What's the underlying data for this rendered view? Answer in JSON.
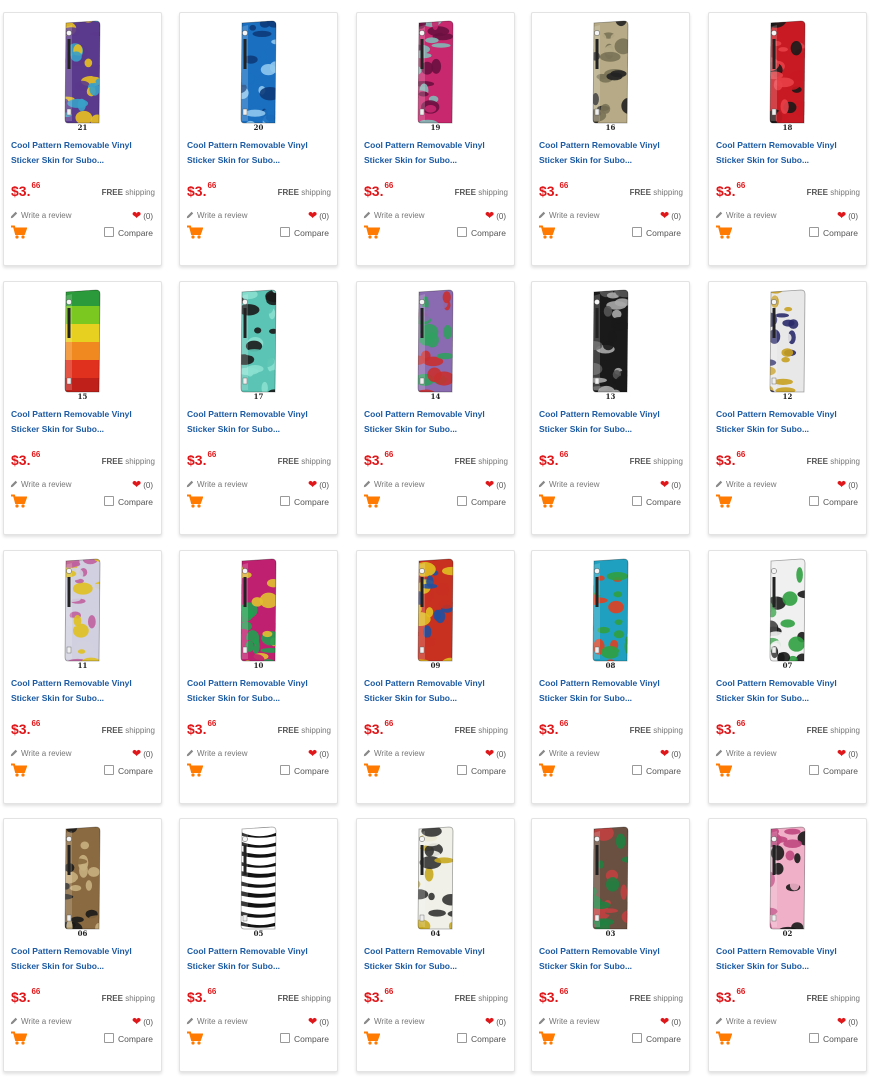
{
  "colors": {
    "title": "#1b5aa3",
    "price": "#e0171a",
    "cart": "#ff7a00"
  },
  "products": [
    {
      "number": "21",
      "title_line1": "Cool Pattern Removable Vinyl",
      "title_line2": "Sticker Skin for Subo...",
      "price_whole": "$3.",
      "price_cents": "66",
      "shipping_free": "FREE",
      "shipping_label": "shipping",
      "review_label": "Write a review",
      "wishlist_count": "(0)",
      "compare_label": "Compare",
      "pattern": "cartoon-monsters",
      "c1": "#5a3a8c",
      "c2": "#e8c020",
      "c3": "#3aa0c8"
    },
    {
      "number": "20",
      "title_line1": "Cool Pattern Removable Vinyl",
      "title_line2": "Sticker Skin for Subo...",
      "price_whole": "$3.",
      "price_cents": "66",
      "shipping_free": "FREE",
      "shipping_label": "shipping",
      "review_label": "Write a review",
      "wishlist_count": "(0)",
      "compare_label": "Compare",
      "pattern": "blue-camo",
      "c1": "#1a6fc0",
      "c2": "#8fc8ee",
      "c3": "#0d3b7a"
    },
    {
      "number": "19",
      "title_line1": "Cool Pattern Removable Vinyl",
      "title_line2": "Sticker Skin for Subo...",
      "price_whole": "$3.",
      "price_cents": "66",
      "shipping_free": "FREE",
      "shipping_label": "shipping",
      "review_label": "Write a review",
      "wishlist_count": "(0)",
      "compare_label": "Compare",
      "pattern": "pink-waves",
      "c1": "#c8286e",
      "c2": "#7fb9b5",
      "c3": "#6a1040"
    },
    {
      "number": "16",
      "title_line1": "Cool Pattern Removable Vinyl",
      "title_line2": "Sticker Skin for Subo...",
      "price_whole": "$3.",
      "price_cents": "66",
      "shipping_free": "FREE",
      "shipping_label": "shipping",
      "review_label": "Write a review",
      "wishlist_count": "(0)",
      "compare_label": "Compare",
      "pattern": "beige-swirl",
      "c1": "#b6ab86",
      "c2": "#222222",
      "c3": "#7a7256"
    },
    {
      "number": "18",
      "title_line1": "Cool Pattern Removable Vinyl",
      "title_line2": "Sticker Skin for Subo...",
      "price_whole": "$3.",
      "price_cents": "66",
      "shipping_free": "FREE",
      "shipping_label": "shipping",
      "review_label": "Write a review",
      "wishlist_count": "(0)",
      "compare_label": "Compare",
      "pattern": "red-lace",
      "c1": "#c81a22",
      "c2": "#1a1a1a",
      "c3": "#e84048"
    },
    {
      "number": "15",
      "title_line1": "Cool Pattern Removable Vinyl",
      "title_line2": "Sticker Skin for Subo...",
      "price_whole": "$3.",
      "price_cents": "66",
      "shipping_free": "FREE",
      "shipping_label": "shipping",
      "review_label": "Write a review",
      "wishlist_count": "(0)",
      "compare_label": "Compare",
      "pattern": "rainbow-gradient",
      "c1": "#3cbc3c",
      "c2": "#f0c020",
      "c3": "#e0301e"
    },
    {
      "number": "17",
      "title_line1": "Cool Pattern Removable Vinyl",
      "title_line2": "Sticker Skin for Subo...",
      "price_whole": "$3.",
      "price_cents": "66",
      "shipping_free": "FREE",
      "shipping_label": "shipping",
      "review_label": "Write a review",
      "wishlist_count": "(0)",
      "compare_label": "Compare",
      "pattern": "teal-squiggle",
      "c1": "#5cc4b4",
      "c2": "#1a1a1a",
      "c3": "#8ae0d0"
    },
    {
      "number": "14",
      "title_line1": "Cool Pattern Removable Vinyl",
      "title_line2": "Sticker Skin for Subo...",
      "price_whole": "$3.",
      "price_cents": "66",
      "shipping_free": "FREE",
      "shipping_label": "shipping",
      "review_label": "Write a review",
      "wishlist_count": "(0)",
      "compare_label": "Compare",
      "pattern": "sticker-bomb",
      "c1": "#8a6ab0",
      "c2": "#c83030",
      "c3": "#30a060"
    },
    {
      "number": "13",
      "title_line1": "Cool Pattern Removable Vinyl",
      "title_line2": "Sticker Skin for Subo...",
      "price_whole": "$3.",
      "price_cents": "66",
      "shipping_free": "FREE",
      "shipping_label": "shipping",
      "review_label": "Write a review",
      "wishlist_count": "(0)",
      "compare_label": "Compare",
      "pattern": "black-floral",
      "c1": "#1a1a1a",
      "c2": "#aaaaaa",
      "c3": "#555555"
    },
    {
      "number": "12",
      "title_line1": "Cool Pattern Removable Vinyl",
      "title_line2": "Sticker Skin for Subo...",
      "price_whole": "$3.",
      "price_cents": "66",
      "shipping_free": "FREE",
      "shipping_label": "shipping",
      "review_label": "Write a review",
      "wishlist_count": "(0)",
      "compare_label": "Compare",
      "pattern": "license-plates",
      "c1": "#e8e8e8",
      "c2": "#2a2a6a",
      "c3": "#c8a020"
    },
    {
      "number": "11",
      "title_line1": "Cool Pattern Removable Vinyl",
      "title_line2": "Sticker Skin for Subo...",
      "price_whole": "$3.",
      "price_cents": "66",
      "shipping_free": "FREE",
      "shipping_label": "shipping",
      "review_label": "Write a review",
      "wishlist_count": "(0)",
      "compare_label": "Compare",
      "pattern": "doodle-cartoon",
      "c1": "#d0d0e0",
      "c2": "#c060a0",
      "c3": "#e0c020"
    },
    {
      "number": "10",
      "title_line1": "Cool Pattern Removable Vinyl",
      "title_line2": "Sticker Skin for Subo...",
      "price_whole": "$3.",
      "price_cents": "66",
      "shipping_free": "FREE",
      "shipping_label": "shipping",
      "review_label": "Write a review",
      "wishlist_count": "(0)",
      "compare_label": "Compare",
      "pattern": "psychedelic",
      "c1": "#c02070",
      "c2": "#20a050",
      "c3": "#e0c030"
    },
    {
      "number": "09",
      "title_line1": "Cool Pattern Removable Vinyl",
      "title_line2": "Sticker Skin for Subo...",
      "price_whole": "$3.",
      "price_cents": "66",
      "shipping_free": "FREE",
      "shipping_label": "shipping",
      "review_label": "Write a review",
      "wishlist_count": "(0)",
      "compare_label": "Compare",
      "pattern": "graffiti",
      "c1": "#c83020",
      "c2": "#e0c020",
      "c3": "#2050a0"
    },
    {
      "number": "08",
      "title_line1": "Cool Pattern Removable Vinyl",
      "title_line2": "Sticker Skin for Subo...",
      "price_whole": "$3.",
      "price_cents": "66",
      "shipping_free": "FREE",
      "shipping_label": "shipping",
      "review_label": "Write a review",
      "wishlist_count": "(0)",
      "compare_label": "Compare",
      "pattern": "sticker-collage",
      "c1": "#20a0c0",
      "c2": "#e04020",
      "c3": "#30a040"
    },
    {
      "number": "07",
      "title_line1": "Cool Pattern Removable Vinyl",
      "title_line2": "Sticker Skin for Subo...",
      "price_whole": "$3.",
      "price_cents": "66",
      "shipping_free": "FREE",
      "shipping_label": "shipping",
      "review_label": "Write a review",
      "wishlist_count": "(0)",
      "compare_label": "Compare",
      "pattern": "bw-stickers",
      "c1": "#f0f0f0",
      "c2": "#1a1a1a",
      "c3": "#30a040"
    },
    {
      "number": "06",
      "title_line1": "Cool Pattern Removable Vinyl",
      "title_line2": "Sticker Skin for Subo...",
      "price_whole": "$3.",
      "price_cents": "66",
      "shipping_free": "FREE",
      "shipping_label": "shipping",
      "review_label": "Write a review",
      "wishlist_count": "(0)",
      "compare_label": "Compare",
      "pattern": "desert-camo",
      "c1": "#8a6a40",
      "c2": "#1a1a1a",
      "c3": "#c8b080"
    },
    {
      "number": "05",
      "title_line1": "Cool Pattern Removable Vinyl",
      "title_line2": "Sticker Skin for Subo...",
      "price_whole": "$3.",
      "price_cents": "66",
      "shipping_free": "FREE",
      "shipping_label": "shipping",
      "review_label": "Write a review",
      "wishlist_count": "(0)",
      "compare_label": "Compare",
      "pattern": "zebra",
      "c1": "#ffffff",
      "c2": "#111111",
      "c3": "#888888"
    },
    {
      "number": "04",
      "title_line1": "Cool Pattern Removable Vinyl",
      "title_line2": "Sticker Skin for Subo...",
      "price_whole": "$3.",
      "price_cents": "66",
      "shipping_free": "FREE",
      "shipping_label": "shipping",
      "review_label": "Write a review",
      "wishlist_count": "(0)",
      "compare_label": "Compare",
      "pattern": "cartoon-faces",
      "c1": "#f0f0e8",
      "c2": "#c8a820",
      "c3": "#333333"
    },
    {
      "number": "03",
      "title_line1": "Cool Pattern Removable Vinyl",
      "title_line2": "Sticker Skin for Subo...",
      "price_whole": "$3.",
      "price_cents": "66",
      "shipping_free": "FREE",
      "shipping_label": "shipping",
      "review_label": "Write a review",
      "wishlist_count": "(0)",
      "compare_label": "Compare",
      "pattern": "patchwork",
      "c1": "#6a5040",
      "c2": "#c04040",
      "c3": "#208040"
    },
    {
      "number": "02",
      "title_line1": "Cool Pattern Removable Vinyl",
      "title_line2": "Sticker Skin for Subo...",
      "price_whole": "$3.",
      "price_cents": "66",
      "shipping_free": "FREE",
      "shipping_label": "shipping",
      "review_label": "Write a review",
      "wishlist_count": "(0)",
      "compare_label": "Compare",
      "pattern": "pink-leopard",
      "c1": "#f0b0c8",
      "c2": "#1a1a1a",
      "c3": "#c04880"
    }
  ]
}
